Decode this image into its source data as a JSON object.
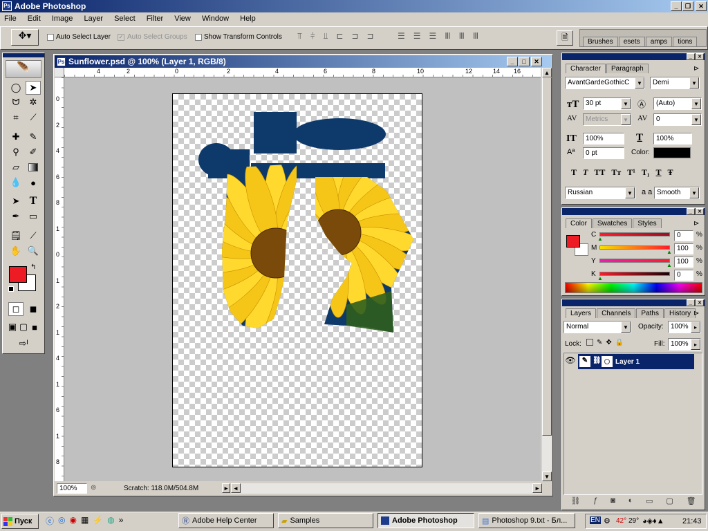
{
  "app": {
    "title": "Adobe Photoshop"
  },
  "menu": [
    "File",
    "Edit",
    "Image",
    "Layer",
    "Select",
    "Filter",
    "View",
    "Window",
    "Help"
  ],
  "options_bar": {
    "auto_select_layer": "Auto Select Layer",
    "auto_select_groups": "Auto Select Groups",
    "show_transform_controls": "Show Transform Controls"
  },
  "well_tabs": [
    "Brushes",
    "esets",
    "amps",
    "tions"
  ],
  "document": {
    "title": "Sunflower.psd @ 100% (Layer 1, RGB/8)",
    "zoom": "100%",
    "scratch": "Scratch: 118.0M/504.8M",
    "ruler_h": [
      "4",
      "2",
      "0",
      "2",
      "4",
      "6",
      "8",
      "10",
      "12",
      "14",
      "16"
    ],
    "ruler_v": [
      "0",
      "2",
      "4",
      "6",
      "8",
      "1",
      "0",
      "1",
      "2",
      "1",
      "4",
      "1",
      "6",
      "1",
      "8"
    ]
  },
  "character": {
    "tabs": [
      "Character",
      "Paragraph"
    ],
    "font_family": "AvantGardeGothicC",
    "font_style": "Demi",
    "size": "30 pt",
    "leading": "(Auto)",
    "kerning": "Metrics",
    "tracking": "0",
    "vscale": "100%",
    "hscale": "100%",
    "baseline": "0 pt",
    "color_label": "Color:",
    "color": "#000000",
    "style_buttons": [
      "T",
      "T",
      "TT",
      "Tт",
      "T¹",
      "T₁",
      "T",
      "Ŧ"
    ],
    "language": "Russian",
    "aa_label": "a a",
    "antialias": "Smooth"
  },
  "color_panel": {
    "tabs": [
      "Color",
      "Swatches",
      "Styles"
    ],
    "fg": "#ed1c24",
    "bg": "#ffffff",
    "channels": [
      {
        "label": "C",
        "value": "0"
      },
      {
        "label": "M",
        "value": "100"
      },
      {
        "label": "Y",
        "value": "100"
      },
      {
        "label": "K",
        "value": "0"
      }
    ],
    "pct": "%"
  },
  "layers_panel": {
    "tabs": [
      "Layers",
      "Channels",
      "Paths",
      "History"
    ],
    "blend_mode": "Normal",
    "opacity_label": "Opacity:",
    "opacity": "100%",
    "lock_label": "Lock:",
    "fill_label": "Fill:",
    "fill": "100%",
    "layer_name": "Layer 1",
    "selected_color": "#0a246a"
  },
  "taskbar": {
    "start": "Пуск",
    "items": [
      "Adobe Help Center",
      "Samples",
      "Adobe Photoshop",
      "Photoshop 9.txt - Бл..."
    ],
    "lang": "EN",
    "temp1": "42°",
    "temp2": "29°",
    "time": "21:43",
    "more": "»"
  },
  "colors": {
    "doc_bg": "#c0c0c0",
    "bottle_blue": "#0e3a6b",
    "sunflower": "#f5c518"
  }
}
